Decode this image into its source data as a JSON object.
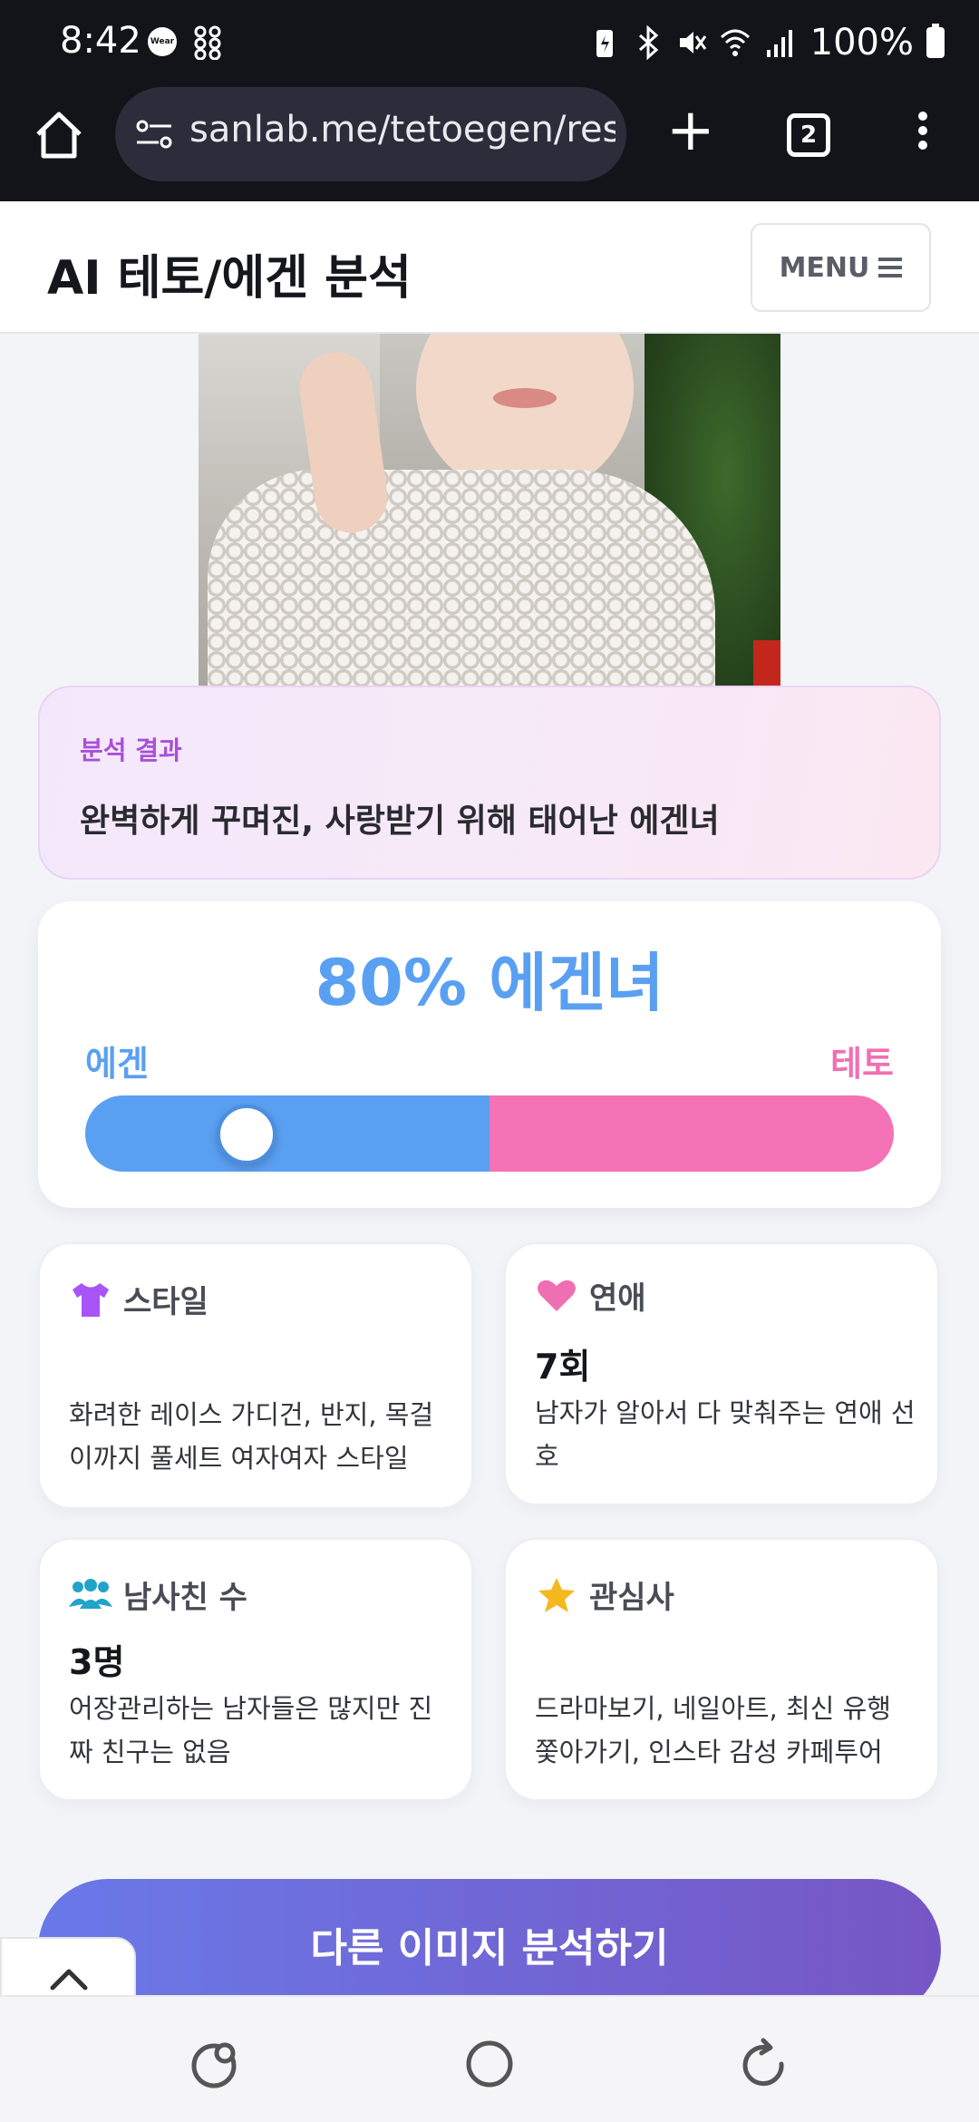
{
  "status_bar": {
    "time": "8:42",
    "wear_label": "Wear",
    "battery": "100%",
    "icons": [
      "wear-icon",
      "app-grid-icon",
      "battery-saver-icon",
      "bluetooth-icon",
      "mute-icon",
      "wifi-icon",
      "signal-icon",
      "battery-icon"
    ]
  },
  "browser": {
    "url": "sanlab.me/tetoegen/result",
    "tab_count": "2",
    "icons": [
      "home-icon",
      "site-settings-icon",
      "plus-icon",
      "tabs-icon",
      "more-icon"
    ]
  },
  "header": {
    "title": "AI 테토/에겐 분석",
    "menu_label": "MENU"
  },
  "result": {
    "label": "분석 결과",
    "text": "완벽하게 꾸며진, 사랑받기 위해 태어난 에겐녀"
  },
  "score": {
    "title": "80% 에겐녀",
    "left_label": "에겐",
    "right_label": "테토",
    "egen_percent": 80,
    "thumb_position": 0.2,
    "colors": {
      "egen": "#5aa0f2",
      "teto": "#f472b6"
    }
  },
  "cards": {
    "style": {
      "icon": "tshirt-icon",
      "title": "스타일",
      "value": "",
      "desc": "화려한 레이스 가디건, 반지, 목걸이까지 풀세트 여자여자 스타일"
    },
    "love": {
      "icon": "heart-icon",
      "title": "연애",
      "value": "7회",
      "desc": "남자가 알아서 다 맞춰주는 연애 선호"
    },
    "friends": {
      "icon": "users-icon",
      "title": "남사친 수",
      "value": "3명",
      "desc": "어장관리하는 남자들은 많지만 진짜 친구는 없음"
    },
    "interest": {
      "icon": "star-icon",
      "title": "관심사",
      "value": "",
      "desc": "드라마보기, 네일아트, 최신 유행 쫓아가기, 인스타 감성 카페투어"
    }
  },
  "cta": {
    "label": "다른 이미지 분석하기"
  },
  "nav": {
    "icons": [
      "recents-icon",
      "home-circle-icon",
      "back-icon"
    ]
  },
  "accent_colors": {
    "purple": "#a94fd8",
    "blue": "#5aa0f2",
    "pink": "#f472b6"
  }
}
